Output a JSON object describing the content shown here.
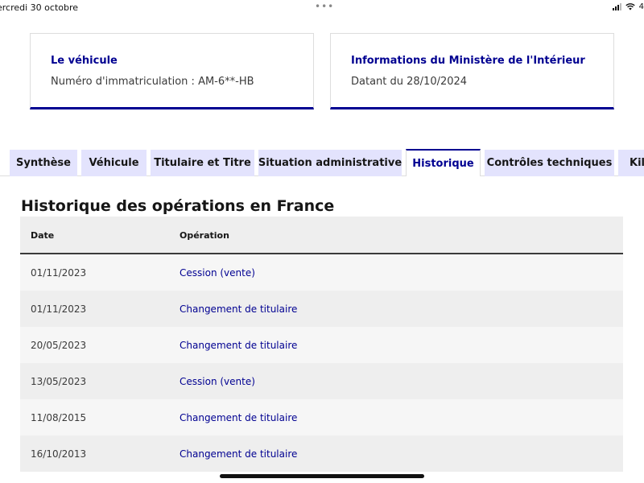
{
  "status_bar": {
    "date": "ercredi 30 octobre",
    "dots": "•••",
    "battery": "4"
  },
  "cards": {
    "vehicle": {
      "title": "Le véhicule",
      "text": "Numéro d'immatriculation : AM-6**-HB"
    },
    "ministry": {
      "title": "Informations du Ministère de l'Intérieur",
      "text": "Datant du 28/10/2024"
    }
  },
  "tabs": [
    {
      "label": "Synthèse",
      "active": false
    },
    {
      "label": "Véhicule",
      "active": false
    },
    {
      "label": "Titulaire et Titre",
      "active": false
    },
    {
      "label": "Situation administrative",
      "active": false
    },
    {
      "label": "Historique",
      "active": true
    },
    {
      "label": "Contrôles techniques",
      "active": false
    },
    {
      "label": "Kil",
      "active": false
    }
  ],
  "history": {
    "title": "Historique des opérations en France",
    "columns": [
      "Date",
      "Opération"
    ],
    "rows": [
      {
        "date": "01/11/2023",
        "operation": "Cession (vente)"
      },
      {
        "date": "01/11/2023",
        "operation": "Changement de titulaire"
      },
      {
        "date": "20/05/2023",
        "operation": "Changement de titulaire"
      },
      {
        "date": "13/05/2023",
        "operation": "Cession (vente)"
      },
      {
        "date": "11/08/2015",
        "operation": "Changement de titulaire"
      },
      {
        "date": "16/10/2013",
        "operation": "Changement de titulaire"
      }
    ]
  },
  "colors": {
    "accent": "#000091",
    "tab_background": "#e3e3fd",
    "header_background": "#eeeeee"
  }
}
